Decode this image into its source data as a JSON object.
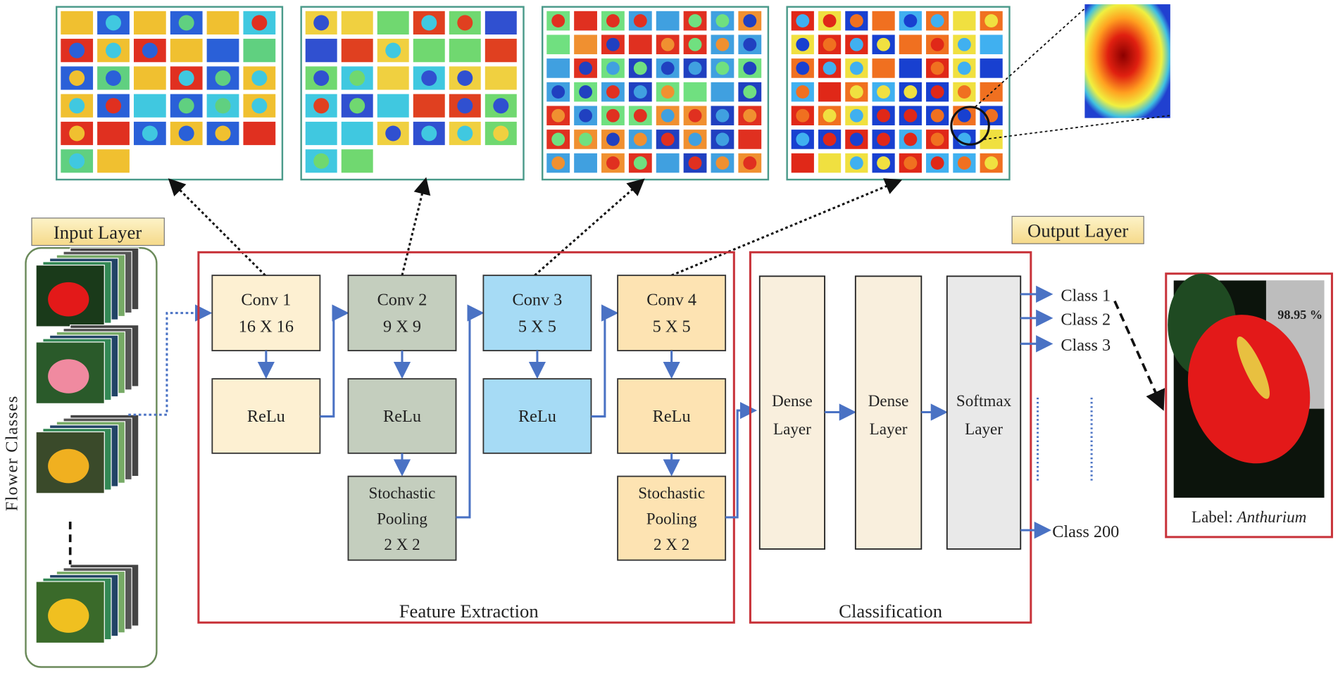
{
  "labels": {
    "input_layer": "Input Layer",
    "output_layer": "Output Layer",
    "flower_classes": "Flower Classes",
    "feature_extraction": "Feature Extraction",
    "classification": "Classification"
  },
  "feature_blocks": [
    {
      "conv": "Conv 1",
      "size": "16 X 16",
      "relu": "ReLu",
      "color": "#fdf0d2"
    },
    {
      "conv": "Conv 2",
      "size": "9 X 9",
      "relu": "ReLu",
      "pool": [
        "Stochastic",
        "Pooling",
        "2 X 2"
      ],
      "color": "#c4cebe"
    },
    {
      "conv": "Conv 3",
      "size": "5 X 5",
      "relu": "ReLu",
      "color": "#a6dbf5"
    },
    {
      "conv": "Conv 4",
      "size": "5 X 5",
      "relu": "ReLu",
      "pool": [
        "Stochastic",
        "Pooling",
        "2 X 2"
      ],
      "color": "#fde3b2"
    }
  ],
  "classification_layers": [
    {
      "line1": "Dense",
      "line2": "Layer"
    },
    {
      "line1": "Dense",
      "line2": "Layer"
    },
    {
      "line1": "Softmax",
      "line2": "Layer"
    }
  ],
  "classes": [
    "Class 1",
    "Class 2",
    "Class 3",
    "Class 200"
  ],
  "output": {
    "confidence": "98.95 %",
    "label_prefix": "Label:",
    "label_value": "Anthurium"
  },
  "feature_maps": [
    {
      "count": 32,
      "cols": 6
    },
    {
      "count": 32,
      "cols": 6
    },
    {
      "count": 56,
      "cols": 8
    },
    {
      "count": 56,
      "cols": 8
    }
  ],
  "colors": {
    "frame_red": "#c8333a",
    "arrow_blue": "#4a72c4",
    "input_border": "#6b8a5a"
  }
}
